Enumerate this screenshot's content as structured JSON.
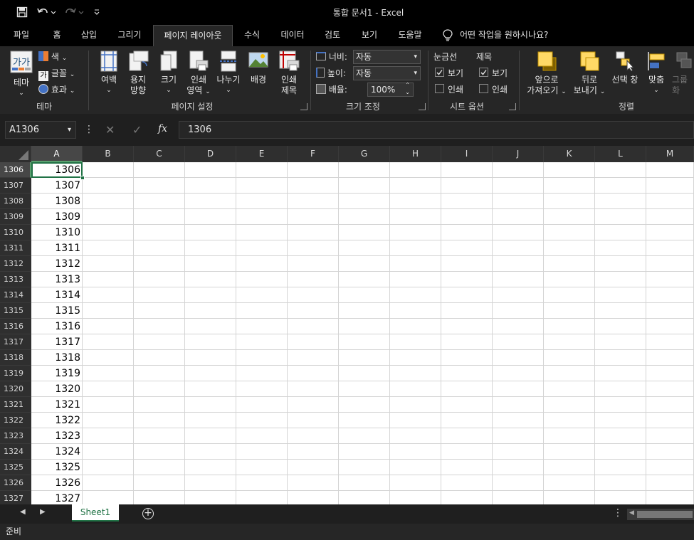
{
  "titlebar": {
    "title": "통합 문서1  -  Excel"
  },
  "tabs": [
    "파일",
    "홈",
    "삽입",
    "그리기",
    "페이지 레이아웃",
    "수식",
    "데이터",
    "검토",
    "보기",
    "도움말"
  ],
  "tell_me": "어떤 작업을 원하시나요?",
  "ribbon": {
    "theme": {
      "theme_label": "테마",
      "colors": "색",
      "fonts": "글꼴",
      "effects": "효과",
      "group": "테마"
    },
    "page_setup": {
      "margins": "여백",
      "orientation_1": "용지",
      "orientation_2": "방향",
      "size": "크기",
      "print_area_1": "인쇄",
      "print_area_2": "영역",
      "breaks": "나누기",
      "background": "배경",
      "print_titles_1": "인쇄",
      "print_titles_2": "제목",
      "group": "페이지 설정"
    },
    "scale": {
      "width_label": "너비:",
      "width_value": "자동",
      "height_label": "높이:",
      "height_value": "자동",
      "scale_label": "배율:",
      "scale_value": "100%",
      "group": "크기 조정"
    },
    "sheet_options": {
      "gridlines": "눈금선",
      "headings": "제목",
      "view": "보기",
      "print": "인쇄",
      "group": "시트 옵션"
    },
    "arrange": {
      "bring_forward_1": "앞으로",
      "bring_forward_2": "가져오기",
      "send_backward_1": "뒤로",
      "send_backward_2": "보내기",
      "selection_pane": "선택 창",
      "align": "맞춤",
      "group_1": "그룹",
      "group_2": "화",
      "group": "정렬"
    }
  },
  "formula_bar": {
    "name_box": "A1306",
    "formula": "1306"
  },
  "columns": [
    "A",
    "B",
    "C",
    "D",
    "E",
    "F",
    "G",
    "H",
    "I",
    "J",
    "K",
    "L",
    "M"
  ],
  "rows": [
    {
      "num": "1306",
      "a": "1306"
    },
    {
      "num": "1307",
      "a": "1307"
    },
    {
      "num": "1308",
      "a": "1308"
    },
    {
      "num": "1309",
      "a": "1309"
    },
    {
      "num": "1310",
      "a": "1310"
    },
    {
      "num": "1311",
      "a": "1311"
    },
    {
      "num": "1312",
      "a": "1312"
    },
    {
      "num": "1313",
      "a": "1313"
    },
    {
      "num": "1314",
      "a": "1314"
    },
    {
      "num": "1315",
      "a": "1315"
    },
    {
      "num": "1316",
      "a": "1316"
    },
    {
      "num": "1317",
      "a": "1317"
    },
    {
      "num": "1318",
      "a": "1318"
    },
    {
      "num": "1319",
      "a": "1319"
    },
    {
      "num": "1320",
      "a": "1320"
    },
    {
      "num": "1321",
      "a": "1321"
    },
    {
      "num": "1322",
      "a": "1322"
    },
    {
      "num": "1323",
      "a": "1323"
    },
    {
      "num": "1324",
      "a": "1324"
    },
    {
      "num": "1325",
      "a": "1325"
    },
    {
      "num": "1326",
      "a": "1326"
    },
    {
      "num": "1327",
      "a": "1327"
    }
  ],
  "sheet_tab": "Sheet1",
  "status": "준비",
  "colors": {
    "accent": "#217346",
    "dark": "#000000",
    "ribbon": "#262626"
  }
}
